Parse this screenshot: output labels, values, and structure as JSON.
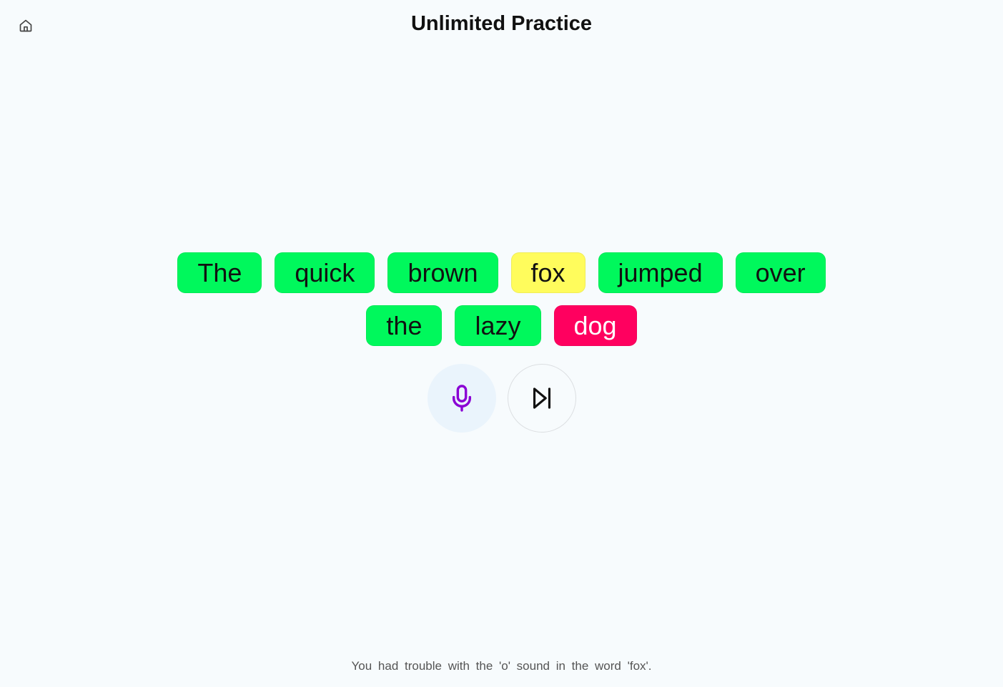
{
  "header": {
    "title": "Unlimited Practice",
    "home_icon": "home-icon"
  },
  "words": [
    [
      {
        "text": "The",
        "status": "correct",
        "bg": "#00f85c",
        "fg": "#111111"
      },
      {
        "text": "quick",
        "status": "correct",
        "bg": "#00f85c",
        "fg": "#111111"
      },
      {
        "text": "brown",
        "status": "correct",
        "bg": "#00f85c",
        "fg": "#111111"
      },
      {
        "text": "fox",
        "status": "partial",
        "bg": "#fffc5c",
        "fg": "#111111"
      },
      {
        "text": "jumped",
        "status": "correct",
        "bg": "#00f85c",
        "fg": "#111111"
      },
      {
        "text": "over",
        "status": "correct",
        "bg": "#00f85c",
        "fg": "#111111"
      }
    ],
    [
      {
        "text": "the",
        "status": "correct",
        "bg": "#00f85c",
        "fg": "#111111"
      },
      {
        "text": "lazy",
        "status": "correct",
        "bg": "#00f85c",
        "fg": "#111111"
      },
      {
        "text": "dog",
        "status": "incorrect",
        "bg": "#ff005f",
        "fg": "#ffffff"
      }
    ]
  ],
  "controls": {
    "mic_icon": "microphone-icon",
    "mic_color": "#8a00d4",
    "skip_icon": "skip-forward-icon"
  },
  "feedback": "You had trouble with the 'o' sound in the word 'fox'."
}
